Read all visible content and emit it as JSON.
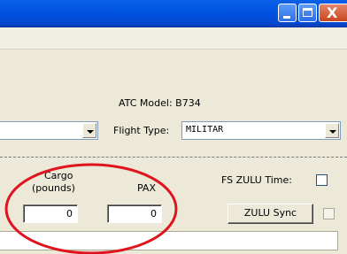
{
  "window": {
    "minimize_glyph": "_",
    "maximize_glyph": "□",
    "close_glyph": "X"
  },
  "flight": {
    "atc_model_label": "ATC Model: B734",
    "flight_type_label": "Flight Type:",
    "flight_type_value": "MILITAR",
    "left_combo_value": ""
  },
  "payload": {
    "cargo_label_line1": "Cargo",
    "cargo_label_line2": "(pounds)",
    "pax_label": "PAX",
    "cargo_value": "0",
    "pax_value": "0"
  },
  "zulu": {
    "fs_zulu_time_label": "FS ZULU Time:",
    "zulu_sync_button": "ZULU Sync"
  },
  "annotation": {
    "color": "#e0141e"
  }
}
